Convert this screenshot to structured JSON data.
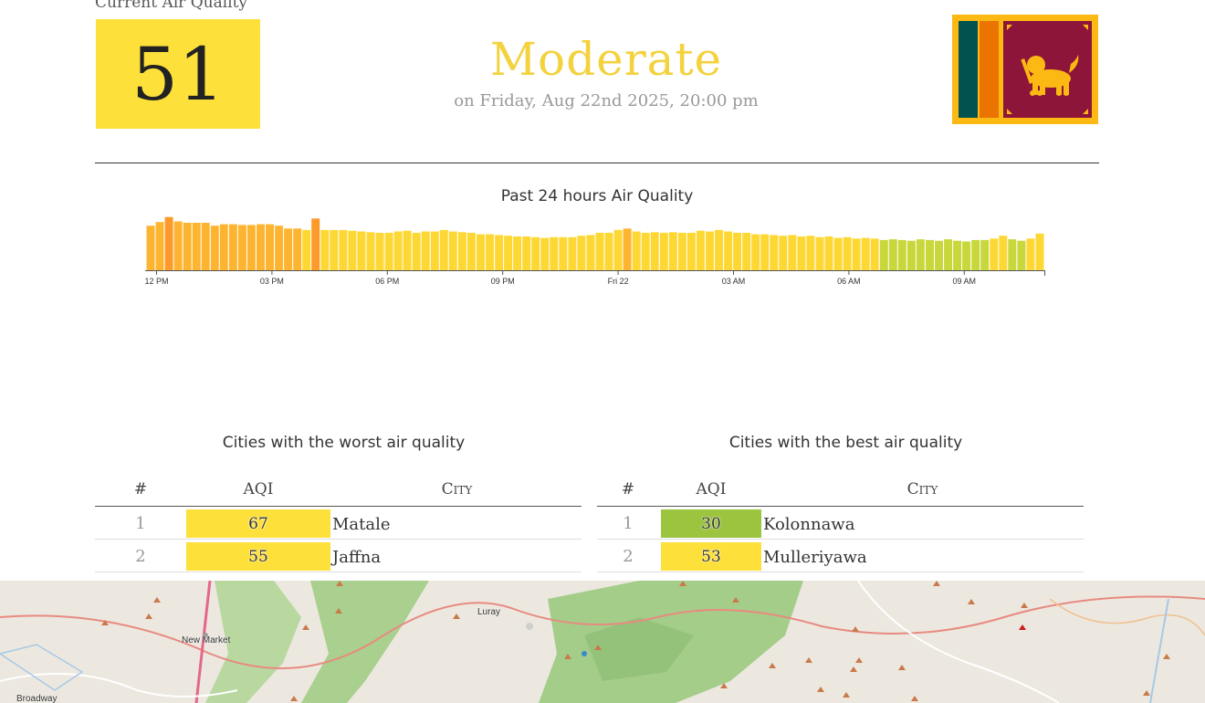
{
  "current": {
    "label": "Current Air Quality",
    "aqi": "51",
    "status": "Moderate",
    "date": "on Friday, Aug 22nd 2025, 20:00 pm",
    "status_color": "#f3d23e",
    "box_color": "#fde03a"
  },
  "flag": {
    "icon": "sri-lanka-flag-icon",
    "colors": {
      "border": "#fdb913",
      "green": "#00534e",
      "orange": "#eb7400",
      "maroon": "#8d153a"
    }
  },
  "chart_data": {
    "type": "bar",
    "title": "Past 24 hours Air Quality",
    "x_ticks": [
      "12 PM",
      "03 PM",
      "06 PM",
      "09 PM",
      "Fri 22",
      "03 AM",
      "06 AM",
      "09 AM"
    ],
    "values": [
      62,
      67,
      74,
      68,
      66,
      66,
      66,
      62,
      64,
      64,
      63,
      63,
      64,
      64,
      62,
      58,
      58,
      56,
      72,
      56,
      56,
      56,
      55,
      54,
      53,
      52,
      52,
      54,
      55,
      52,
      54,
      54,
      56,
      54,
      53,
      52,
      50,
      50,
      49,
      48,
      47,
      47,
      46,
      45,
      46,
      46,
      46,
      48,
      49,
      52,
      52,
      56,
      58,
      54,
      52,
      53,
      52,
      53,
      52,
      52,
      55,
      54,
      56,
      54,
      52,
      52,
      50,
      50,
      49,
      48,
      49,
      47,
      48,
      46,
      47,
      45,
      46,
      44,
      45,
      44,
      42,
      43,
      42,
      41,
      43,
      42,
      41,
      43,
      41,
      40,
      42,
      42,
      44,
      48,
      43,
      41,
      44,
      51
    ],
    "ylim": [
      0,
      80
    ],
    "grid": false,
    "bar_colors": {
      "good": "#c8d83c",
      "moderate": "#fdd835",
      "elevated": "#fdb531",
      "peak": "#fd9a2b"
    }
  },
  "worst_table": {
    "title": "Cities with the worst air quality",
    "headers": {
      "rank": "#",
      "aqi": "AQI",
      "city": "City"
    },
    "rows": [
      {
        "rank": "1",
        "aqi": "67",
        "city": "Matale",
        "color": "#fde03a"
      },
      {
        "rank": "2",
        "aqi": "55",
        "city": "Jaffna",
        "color": "#fde03a"
      }
    ]
  },
  "best_table": {
    "title": "Cities with the best air quality",
    "headers": {
      "rank": "#",
      "aqi": "AQI",
      "city": "City"
    },
    "rows": [
      {
        "rank": "1",
        "aqi": "30",
        "city": "Kolonnawa",
        "color": "#9dc43f"
      },
      {
        "rank": "2",
        "aqi": "53",
        "city": "Mulleriyawa",
        "color": "#fde03a"
      }
    ]
  },
  "map": {
    "labels": [
      "Luray",
      "New Market",
      "Broadway"
    ]
  }
}
